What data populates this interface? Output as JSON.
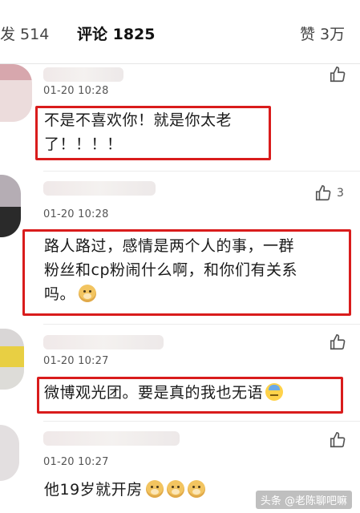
{
  "tabs": {
    "repost": "发 514",
    "comment": "评论 1825",
    "like": "赞 3万"
  },
  "comments": [
    {
      "time": "01-20 10:28",
      "like_count": "",
      "lines": [
        "不是不喜欢你！就是你太老",
        "了！！！！"
      ]
    },
    {
      "time": "01-20 10:28",
      "like_count": "3",
      "lines": [
        "路人路过，感情是两个人的事，一群",
        "粉丝和cp粉闹什么啊，和你们有关系",
        "吗。"
      ]
    },
    {
      "time": "01-20 10:27",
      "like_count": "",
      "lines": [
        "微博观光团。要是真的我也无语"
      ]
    },
    {
      "time": "01-20 10:27",
      "like_count": "",
      "lines": [
        "他19岁就开房"
      ]
    }
  ],
  "watermark": "头条 @老陈聊吧嘛",
  "colors": {
    "highlight_box": "#d91c1c",
    "timestamp": "#555555"
  }
}
